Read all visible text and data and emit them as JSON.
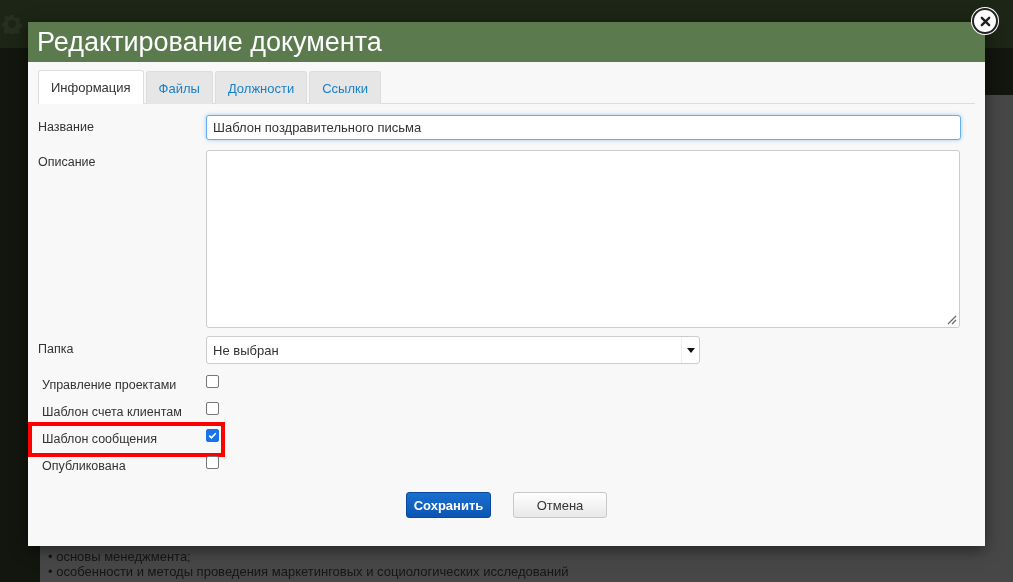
{
  "background": {
    "lines": [
      "• основы менеджмента;",
      "• особенности и методы проведения маркетинговых и социологических исследований"
    ]
  },
  "dialog": {
    "title": "Редактирование документа",
    "tabs": [
      {
        "label": "Информация",
        "selected": true
      },
      {
        "label": "Файлы",
        "selected": false
      },
      {
        "label": "Должности",
        "selected": false
      },
      {
        "label": "Ссылки",
        "selected": false
      }
    ],
    "fields": [
      {
        "kind": "input",
        "label": "Название",
        "value": "Шаблон поздравительного письма",
        "focused": true
      },
      {
        "kind": "textarea",
        "label": "Описание"
      },
      {
        "kind": "select",
        "label": "Папка",
        "value": "Не выбран"
      },
      {
        "kind": "checkbox",
        "label": "Управление проектами",
        "checked": false,
        "highlighted": false
      },
      {
        "kind": "checkbox",
        "label": "Шаблон счета клиентам",
        "checked": false,
        "highlighted": false
      },
      {
        "kind": "checkbox",
        "label": "Шаблон сообщения",
        "checked": true,
        "highlighted": true
      },
      {
        "kind": "checkbox",
        "label": "Опубликована",
        "checked": false,
        "highlighted": false
      }
    ],
    "buttons": [
      {
        "label": "Сохранить",
        "primary": true
      },
      {
        "label": "Отмена",
        "primary": false
      }
    ]
  }
}
